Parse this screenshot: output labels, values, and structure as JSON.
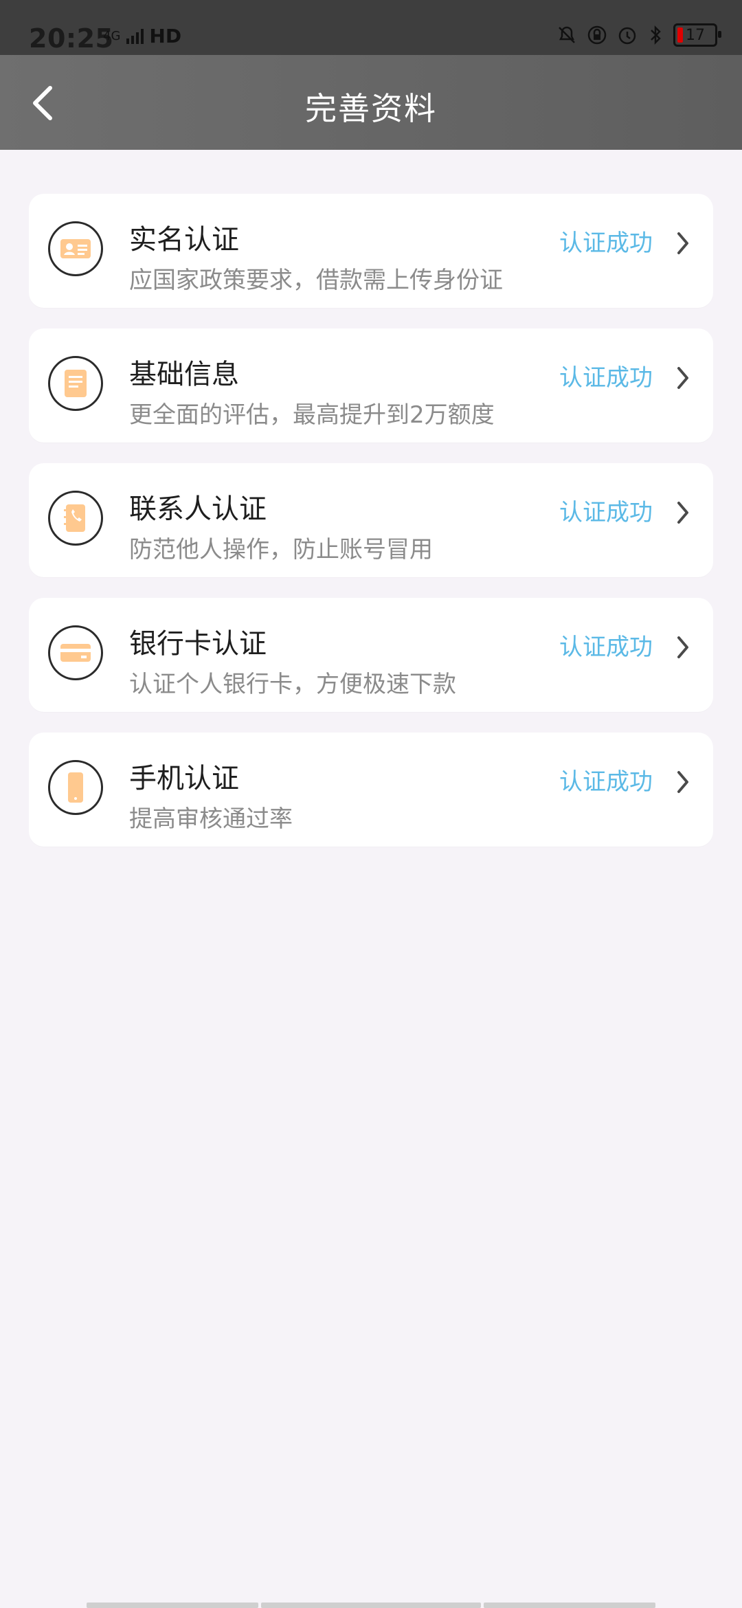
{
  "status_bar": {
    "time": "20:25",
    "network": "4G",
    "hd": "HD",
    "battery": "17"
  },
  "header": {
    "title": "完善资料"
  },
  "items": [
    {
      "title": "实名认证",
      "desc": "应国家政策要求，借款需上传身份证",
      "status": "认证成功",
      "icon": "id-card-icon"
    },
    {
      "title": "基础信息",
      "desc": "更全面的评估，最高提升到2万额度",
      "status": "认证成功",
      "icon": "document-icon"
    },
    {
      "title": "联系人认证",
      "desc": "防范他人操作，防止账号冒用",
      "status": "认证成功",
      "icon": "contacts-phone-icon"
    },
    {
      "title": "银行卡认证",
      "desc": "认证个人银行卡，方便极速下款",
      "status": "认证成功",
      "icon": "bank-card-icon"
    },
    {
      "title": "手机认证",
      "desc": "提高审核通过率",
      "status": "认证成功",
      "icon": "mobile-phone-icon"
    }
  ],
  "colors": {
    "accent_status": "#5bb9e6",
    "icon_fill": "#ffc98f",
    "header_bg": "#666666",
    "page_bg": "#f6f3f8"
  }
}
